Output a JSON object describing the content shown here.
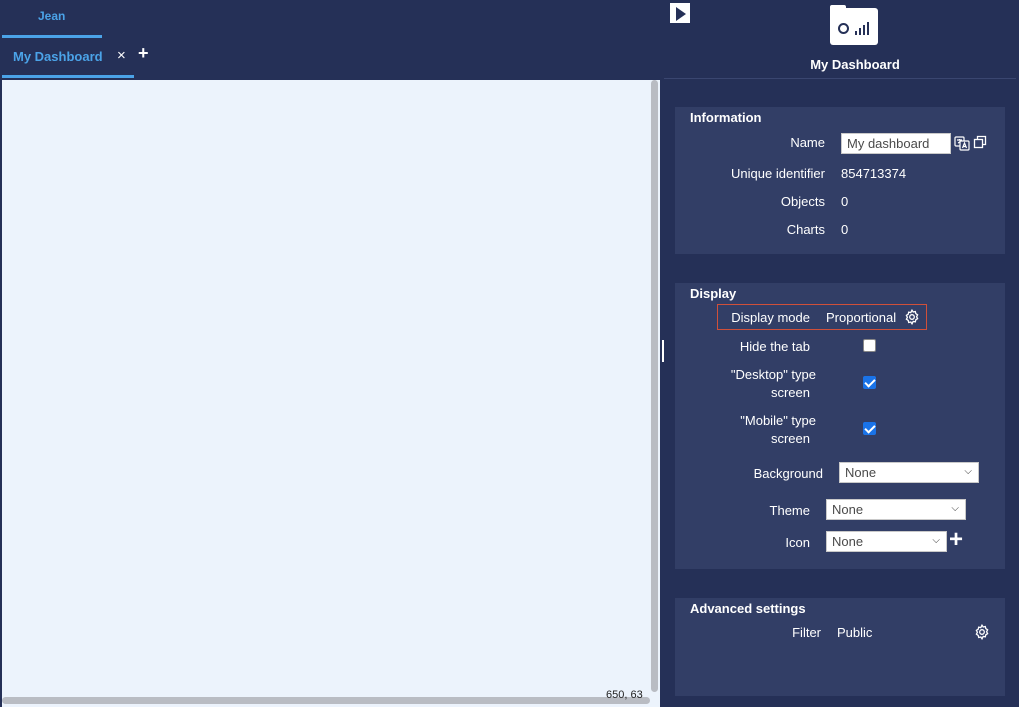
{
  "header": {
    "user_tab": "Jean",
    "doc_tab": "My Dashboard",
    "close_glyph": "×",
    "add_glyph": "+"
  },
  "canvas": {
    "coords": "650, 63"
  },
  "panel": {
    "title": "My Dashboard",
    "icon": "dashboard-folder-icon"
  },
  "information": {
    "title": "Information",
    "name_label": "Name",
    "name_value": "My dashboard",
    "uid_label": "Unique identifier",
    "uid_value": "854713374",
    "objects_label": "Objects",
    "objects_value": "0",
    "charts_label": "Charts",
    "charts_value": "0"
  },
  "display": {
    "title": "Display",
    "mode_label": "Display mode",
    "mode_value": "Proportional",
    "hide_tab_label": "Hide the tab",
    "hide_tab_checked": false,
    "desktop_label_1": "\"Desktop\" type",
    "desktop_label_2": "screen",
    "desktop_checked": true,
    "mobile_label_1": "\"Mobile\" type",
    "mobile_label_2": "screen",
    "mobile_checked": true,
    "background_label": "Background",
    "background_value": "None",
    "theme_label": "Theme",
    "theme_value": "None",
    "icon_label": "Icon",
    "icon_value": "None",
    "add_glyph": "+"
  },
  "advanced": {
    "title": "Advanced settings",
    "filter_label": "Filter",
    "filter_value": "Public"
  },
  "colors": {
    "background": "#253057",
    "section": "#323e66",
    "accent": "#4ba3e8",
    "canvas": "#ecf3fc",
    "highlight_border": "#d0503a",
    "checkbox": "#1a73e8"
  }
}
